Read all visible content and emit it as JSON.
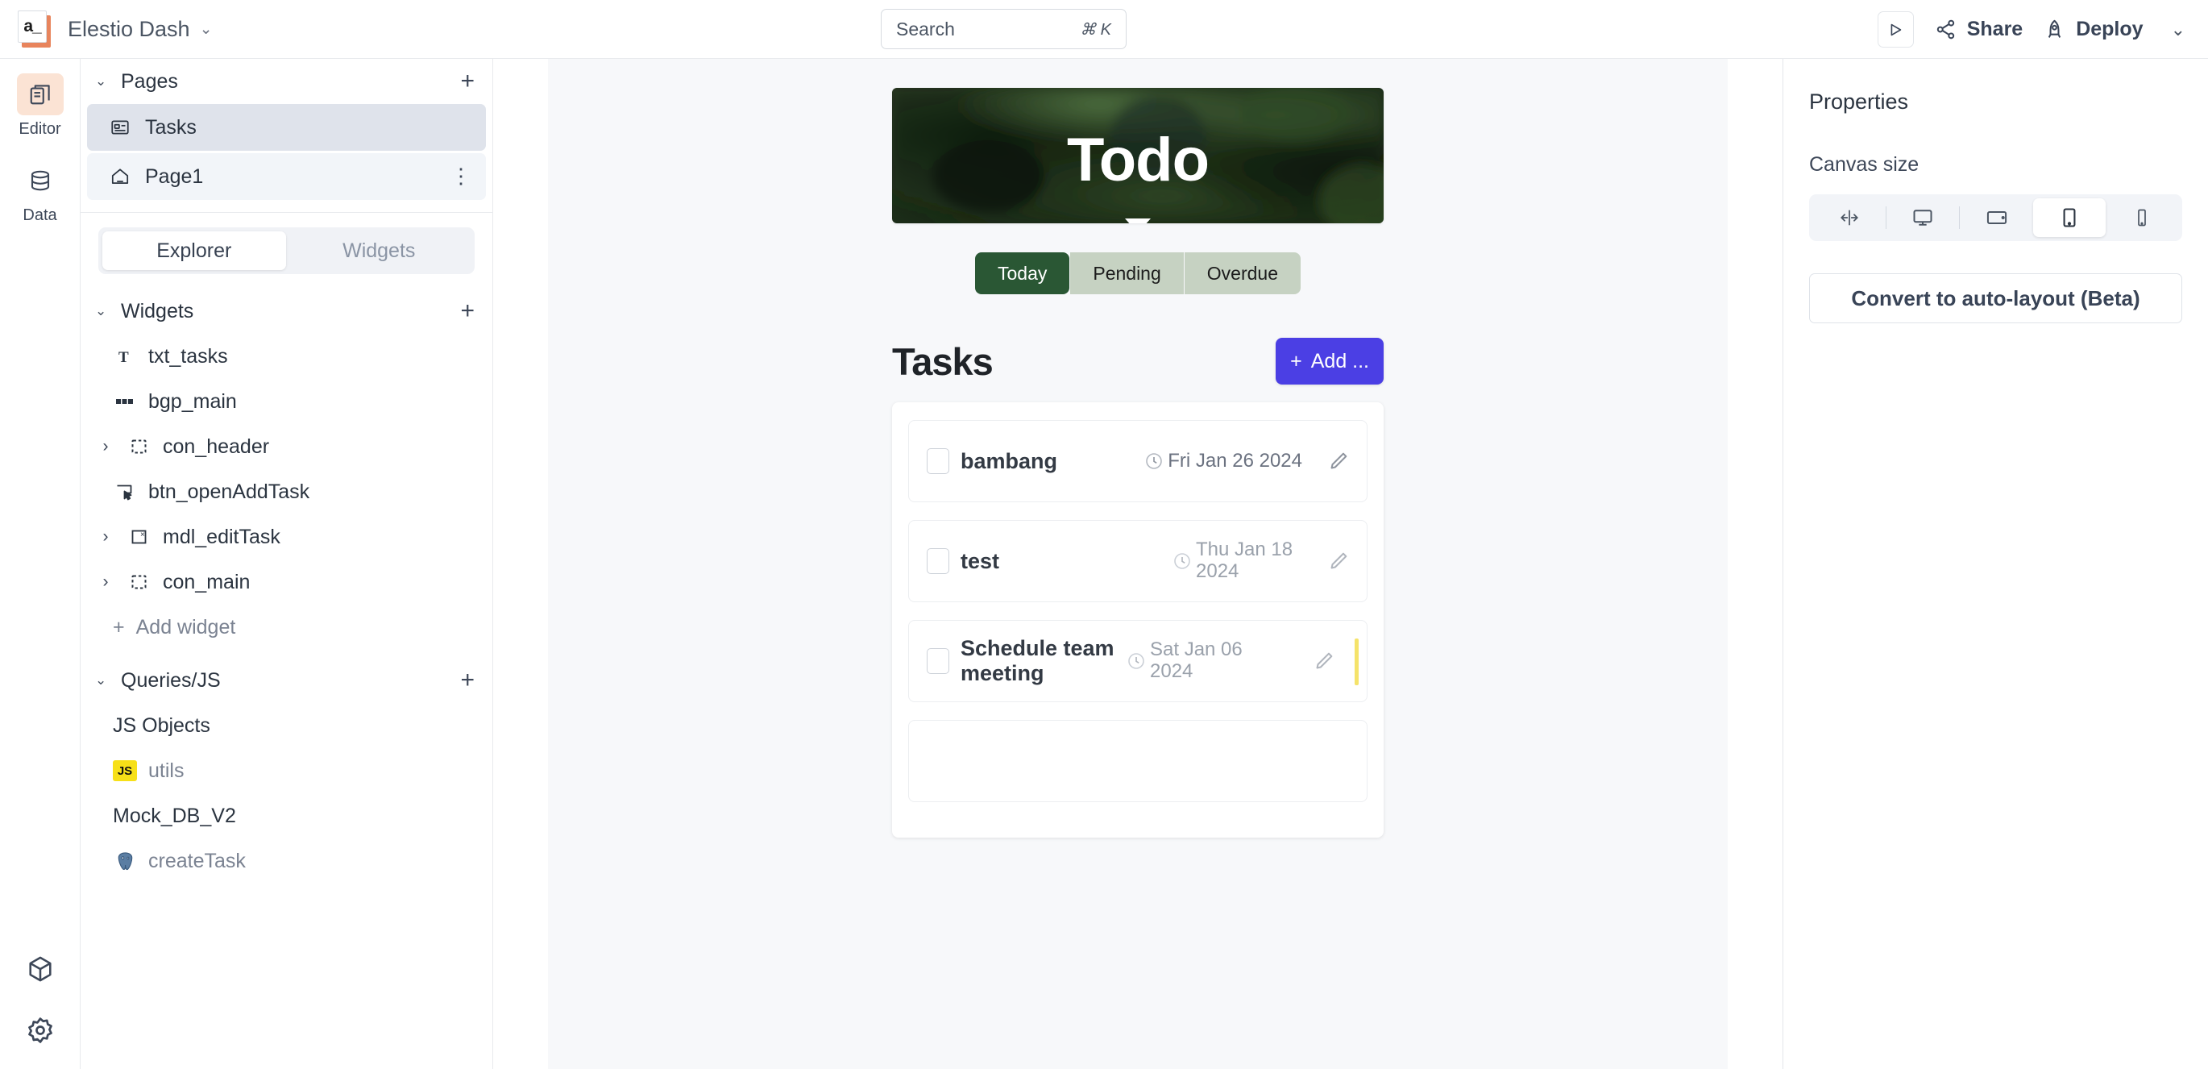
{
  "topbar": {
    "logo_text": "a_",
    "app_name": "Elestio Dash",
    "chevron": "⌄",
    "search": {
      "placeholder": "Search",
      "shortcut": "⌘ K"
    },
    "preview_icon": "play-icon",
    "share_label": "Share",
    "deploy_label": "Deploy",
    "deploy_chevron": "⌄"
  },
  "rail": {
    "items": [
      {
        "label": "Editor",
        "icon": "editor-icon",
        "active": true
      },
      {
        "label": "Data",
        "icon": "database-icon",
        "active": false
      }
    ],
    "bottom": [
      {
        "icon": "cube-icon"
      },
      {
        "icon": "gear-icon"
      }
    ]
  },
  "sidebar": {
    "pages": {
      "title": "Pages",
      "add": "+",
      "caret": "⌄",
      "items": [
        {
          "label": "Tasks",
          "icon": "page-icon",
          "state": "selected"
        },
        {
          "label": "Page1",
          "icon": "home-icon",
          "state": "hover",
          "menu": "⋮"
        }
      ]
    },
    "tabs": [
      {
        "label": "Explorer",
        "active": true
      },
      {
        "label": "Widgets",
        "active": false
      }
    ],
    "widgets": {
      "title": "Widgets",
      "add": "+",
      "caret": "⌄",
      "items": [
        {
          "label": "txt_tasks",
          "icon": "text-widget-icon",
          "expandable": false
        },
        {
          "label": "bgp_main",
          "icon": "button-group-icon",
          "expandable": false
        },
        {
          "label": "con_header",
          "icon": "container-icon",
          "expandable": true,
          "arrow": "›"
        },
        {
          "label": "btn_openAddTask",
          "icon": "button-icon",
          "expandable": false
        },
        {
          "label": "mdl_editTask",
          "icon": "modal-icon",
          "expandable": true,
          "arrow": "›"
        },
        {
          "label": "con_main",
          "icon": "container-icon",
          "expandable": true,
          "arrow": "›"
        }
      ],
      "add_widget_label": "Add widget",
      "add_widget_plus": "+"
    },
    "queries": {
      "title": "Queries/JS",
      "add": "+",
      "caret": "⌄",
      "groups": [
        {
          "label": "JS Objects",
          "items": [
            {
              "label": "utils",
              "icon": "js-icon"
            }
          ]
        },
        {
          "label": "Mock_DB_V2",
          "items": [
            {
              "label": "createTask",
              "icon": "postgres-icon"
            }
          ]
        }
      ]
    }
  },
  "canvas": {
    "hero": {
      "title": "Todo",
      "image": "dark-green-foliage-photo"
    },
    "filters": [
      {
        "label": "Today",
        "active": true
      },
      {
        "label": "Pending",
        "active": false
      },
      {
        "label": "Overdue",
        "active": false
      }
    ],
    "section_title": "Tasks",
    "add_task_button": {
      "label": "Add ...",
      "plus": "+",
      "color": "#4b3fe4"
    },
    "tasks": [
      {
        "name": "bambang",
        "date": "Fri Jan 26 2024",
        "checked": false,
        "clock_icon": "clock-icon",
        "edit_icon": "pencil-icon",
        "flag": false,
        "dim": false
      },
      {
        "name": "test",
        "date": "Thu Jan 18 2024",
        "checked": false,
        "clock_icon": "clock-icon",
        "edit_icon": "pencil-icon",
        "flag": false,
        "dim": true
      },
      {
        "name": "Schedule team meeting",
        "date": "Sat Jan 06 2024",
        "checked": false,
        "clock_icon": "clock-icon",
        "edit_icon": "pencil-icon",
        "flag": true,
        "flag_color": "#f5e36a",
        "dim": true
      }
    ]
  },
  "properties": {
    "title": "Properties",
    "canvas_size_label": "Canvas size",
    "sizes": [
      {
        "icon": "fluid-width-icon",
        "selected": false
      },
      {
        "icon": "desktop-icon",
        "selected": false
      },
      {
        "icon": "tablet-landscape-icon",
        "selected": false
      },
      {
        "icon": "tablet-portrait-icon",
        "selected": true
      },
      {
        "icon": "mobile-icon",
        "selected": false
      }
    ],
    "convert_label": "Convert to auto-layout (Beta)"
  }
}
